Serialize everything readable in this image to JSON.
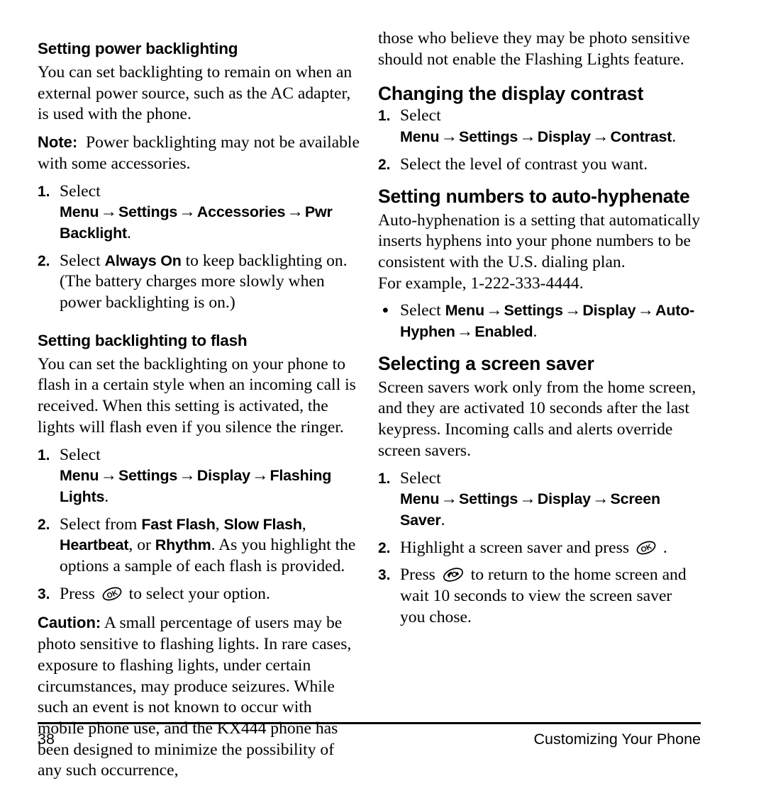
{
  "page": {
    "number": "38",
    "chapter": "Customizing Your Phone",
    "arrow": "→",
    "bullet": "•"
  },
  "icons": {
    "ok_key": "ok-key-icon",
    "end_call_key": "end-call-key-icon",
    "ok_label": "OK"
  },
  "left_column": {
    "sub_heading_1": "Setting power backlighting",
    "intro_paragraph": "You can set backlighting to remain on when an external power source, such as the AC adapter, is used with the phone.",
    "note_label": "Note:",
    "note_text": "Power backlighting may not be available with some accessories.",
    "steps_1": [
      {
        "marker": "1.",
        "lead": "Select",
        "path": [
          "Menu",
          "Settings",
          "Accessories",
          "Pwr Backlight"
        ],
        "tail": "."
      },
      {
        "marker": "2.",
        "lead": "Select",
        "emphasis": "Always On",
        "tail": "to keep backlighting on. (The battery charges more slowly when power backlighting is on.)"
      }
    ],
    "sub_heading_2": "Setting backlighting to flash",
    "flash_paragraph": "You can set the backlighting on your phone to flash in a certain style when an incoming call is received. When this setting is activated, the lights will flash even if you silence the ringer.",
    "steps_2": [
      {
        "marker": "1.",
        "lead": "Select",
        "path": [
          "Menu",
          "Settings",
          "Display",
          "Flashing Lights"
        ],
        "tail": "."
      },
      {
        "marker": "2.",
        "lead": "Select from",
        "options": [
          "Fast Flash",
          "Slow Flash",
          "Heartbeat"
        ],
        "mid": ", or",
        "last_option": "Rhythm",
        "tail": ". As you highlight the options a sample of each flash is provided."
      },
      {
        "marker": "3.",
        "lead": "Press",
        "tail": "to select your option."
      }
    ],
    "caution_label": "Caution:",
    "caution_text": "A small percentage of users may be photo sensitive to flashing lights. In rare cases, exposure to flashing lights, under certain circumstances, may produce seizures. While such an event is not known to occur with mobile phone use, and the KX444 phone has been designed to minimize the possibility of any such occurrence,"
  },
  "right_column": {
    "continued_paragraph": "those who believe they may be photo sensitive should not enable the Flashing Lights feature.",
    "heading_contrast": "Changing the display contrast",
    "steps_contrast": [
      {
        "marker": "1.",
        "lead": "Select",
        "path": [
          "Menu",
          "Settings",
          "Display",
          "Contrast"
        ],
        "tail": "."
      },
      {
        "marker": "2.",
        "text": "Select the level of contrast you want."
      }
    ],
    "heading_hyphen": "Setting numbers to auto-hyphenate",
    "hyphen_paragraph": "Auto-hyphenation is a setting that automatically inserts hyphens into your phone numbers to be consistent with the U.S. dialing plan.",
    "hyphen_example": "For example, 1-222-333-4444.",
    "hyphen_step": {
      "marker": "•",
      "lead": "Select",
      "path": [
        "Menu",
        "Settings",
        "Display",
        "Auto-Hyphen",
        "Enabled"
      ],
      "tail": "."
    },
    "heading_screensaver": "Selecting a screen saver",
    "screensaver_paragraph": "Screen savers work only from the home screen, and they are activated 10 seconds after the last keypress. Incoming calls and alerts override screen savers.",
    "steps_screensaver": [
      {
        "marker": "1.",
        "lead": "Select",
        "path": [
          "Menu",
          "Settings",
          "Display",
          "Screen Saver"
        ],
        "tail": "."
      },
      {
        "marker": "2.",
        "lead": "Highlight a screen saver and press",
        "tail": "."
      },
      {
        "marker": "3.",
        "lead": "Press",
        "tail": "to return to the home screen and wait 10 seconds to view the screen saver you chose."
      }
    ]
  }
}
